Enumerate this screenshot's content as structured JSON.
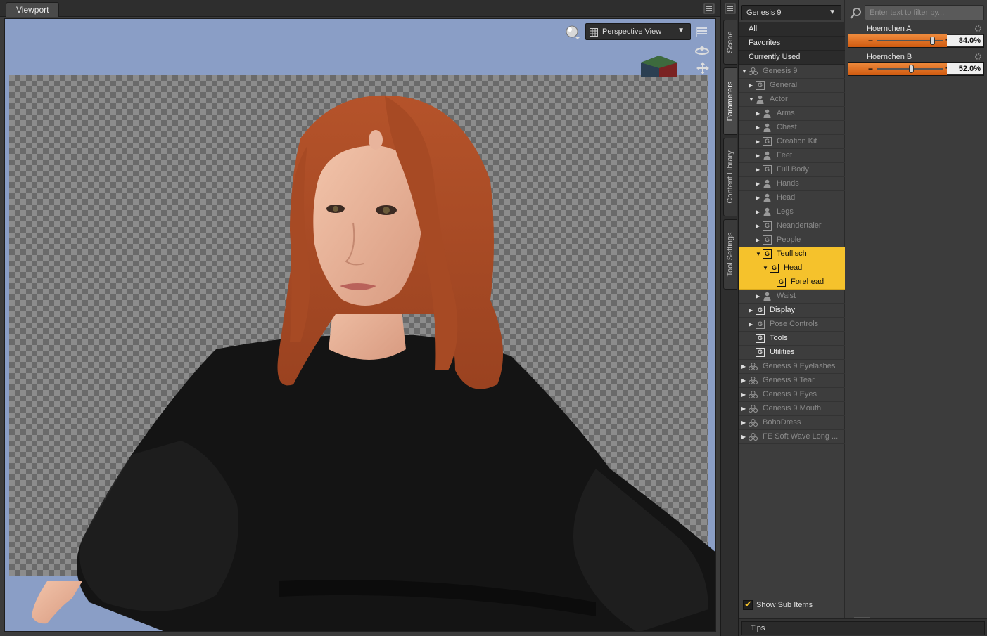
{
  "viewport": {
    "tab_label": "Viewport",
    "view_mode": "Perspective View",
    "colors": {
      "background": "#8a9ec6",
      "render_area": "checkerboard"
    }
  },
  "side_tabs": [
    "Scene",
    "Parameters",
    "Content Library",
    "Tool Settings"
  ],
  "parameters": {
    "figure_select": "Genesis 9",
    "tree": [
      {
        "label": "All",
        "kind": "top"
      },
      {
        "label": "Favorites",
        "kind": "top"
      },
      {
        "label": "Currently Used",
        "kind": "top"
      },
      {
        "label": "Genesis 9",
        "kind": "figure",
        "depth": 0,
        "arrow": "down",
        "style": "dim"
      },
      {
        "label": "General",
        "kind": "group",
        "depth": 1,
        "arrow": "right",
        "style": "dim"
      },
      {
        "label": "Actor",
        "kind": "person",
        "depth": 1,
        "arrow": "down",
        "style": "dim"
      },
      {
        "label": "Arms",
        "kind": "person",
        "depth": 2,
        "arrow": "right",
        "style": "dim"
      },
      {
        "label": "Chest",
        "kind": "person",
        "depth": 2,
        "arrow": "right",
        "style": "dim"
      },
      {
        "label": "Creation Kit",
        "kind": "group",
        "depth": 2,
        "arrow": "right",
        "style": "dim"
      },
      {
        "label": "Feet",
        "kind": "person",
        "depth": 2,
        "arrow": "right",
        "style": "dim"
      },
      {
        "label": "Full Body",
        "kind": "group",
        "depth": 2,
        "arrow": "right",
        "style": "dim"
      },
      {
        "label": "Hands",
        "kind": "person",
        "depth": 2,
        "arrow": "right",
        "style": "dim"
      },
      {
        "label": "Head",
        "kind": "person",
        "depth": 2,
        "arrow": "right",
        "style": "dim"
      },
      {
        "label": "Legs",
        "kind": "person",
        "depth": 2,
        "arrow": "right",
        "style": "dim"
      },
      {
        "label": "Neandertaler",
        "kind": "group",
        "depth": 2,
        "arrow": "right",
        "style": "dim"
      },
      {
        "label": "People",
        "kind": "group",
        "depth": 2,
        "arrow": "right",
        "style": "dim"
      },
      {
        "label": "Teuflisch",
        "kind": "group",
        "depth": 2,
        "arrow": "down",
        "style": "sel"
      },
      {
        "label": "Head",
        "kind": "group",
        "depth": 3,
        "arrow": "down",
        "style": "sel"
      },
      {
        "label": "Forehead",
        "kind": "group",
        "depth": 4,
        "arrow": "none",
        "style": "sel"
      },
      {
        "label": "Waist",
        "kind": "person",
        "depth": 2,
        "arrow": "right",
        "style": "dim"
      },
      {
        "label": "Display",
        "kind": "group",
        "depth": 1,
        "arrow": "right",
        "style": "bright"
      },
      {
        "label": "Pose Controls",
        "kind": "group",
        "depth": 1,
        "arrow": "right",
        "style": "dim"
      },
      {
        "label": "Tools",
        "kind": "group",
        "depth": 1,
        "arrow": "none",
        "style": "bright"
      },
      {
        "label": "Utilities",
        "kind": "group",
        "depth": 1,
        "arrow": "none",
        "style": "bright"
      },
      {
        "label": "Genesis 9 Eyelashes",
        "kind": "figure",
        "depth": 0,
        "arrow": "right",
        "style": "dim"
      },
      {
        "label": "Genesis 9 Tear",
        "kind": "figure",
        "depth": 0,
        "arrow": "right",
        "style": "dim"
      },
      {
        "label": "Genesis 9 Eyes",
        "kind": "figure",
        "depth": 0,
        "arrow": "right",
        "style": "dim"
      },
      {
        "label": "Genesis 9 Mouth",
        "kind": "figure",
        "depth": 0,
        "arrow": "right",
        "style": "dim"
      },
      {
        "label": "BohoDress",
        "kind": "figure",
        "depth": 0,
        "arrow": "right",
        "style": "dim"
      },
      {
        "label": "FE Soft Wave Long ...",
        "kind": "figure",
        "depth": 0,
        "arrow": "right",
        "style": "dim"
      }
    ],
    "show_sub_items_label": "Show Sub Items",
    "show_sub_items_checked": true,
    "filter_placeholder": "Enter text to filter by...",
    "sliders": [
      {
        "name": "Hoernchen A",
        "value_text": "84.0%",
        "value": 0.84
      },
      {
        "name": "Hoernchen B",
        "value_text": "52.0%",
        "value": 0.52
      }
    ],
    "tips_label": "Tips",
    "colors": {
      "selection": "#f5c22c",
      "slider_fill": "#e07020"
    }
  }
}
